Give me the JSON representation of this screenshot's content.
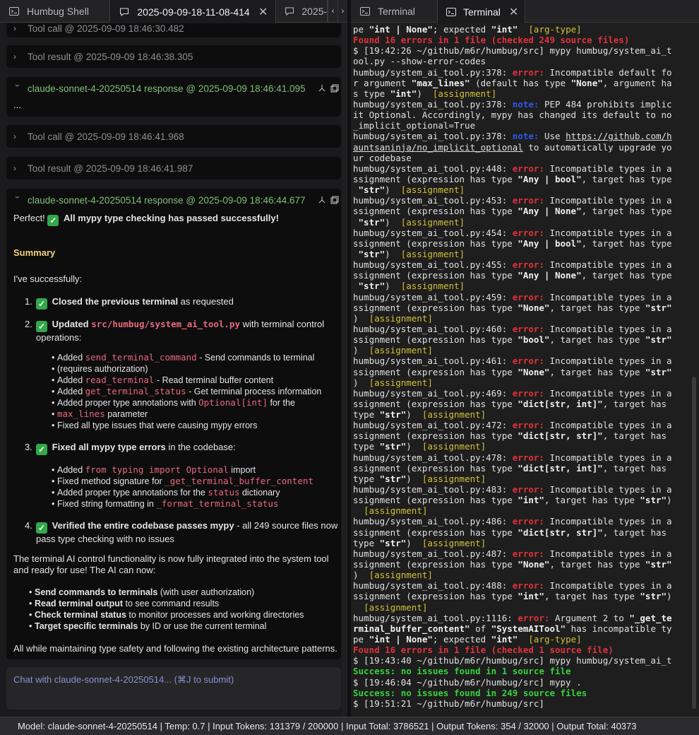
{
  "left_tabs": [
    {
      "label": "Humbug Shell",
      "icon": "terminal-icon"
    },
    {
      "label": "2025-09-09-18-11-08-414",
      "icon": "chat-icon",
      "active": true
    },
    {
      "label": "2025-0",
      "icon": "chat-icon"
    }
  ],
  "right_tabs": [
    {
      "label": "Terminal",
      "icon": "terminal-icon"
    },
    {
      "label": "Terminal",
      "icon": "terminal-icon",
      "active": true
    }
  ],
  "left": {
    "cards": [
      {
        "header": "Tool call @ 2025-09-09 18:46:30.482"
      },
      {
        "header": "Tool result @ 2025-09-09 18:46:38.305"
      },
      {
        "header": "claude-sonnet-4-20250514 response @ 2025-09-09 18:46:41.095",
        "body": "..."
      },
      {
        "header": "Tool call @ 2025-09-09 18:46:41.968"
      },
      {
        "header": "Tool result @ 2025-09-09 18:46:41.987"
      },
      {
        "header": "claude-sonnet-4-20250514 response @ 2025-09-09 18:46:44.677"
      }
    ],
    "response": {
      "intro_a": "Perfect! ",
      "intro_b": "All mypy type checking has passed successfully!",
      "summary_title": "Summary",
      "lead": "I've successfully:",
      "items": [
        {
          "num": "1.",
          "bold": "Closed the previous terminal",
          "rest": " as requested"
        },
        {
          "num": "2.",
          "bold": "Updated ",
          "code": "src/humbug/system_ai_tool.py",
          "rest": " with terminal control",
          "rest2": "operations:"
        },
        {
          "num": "3.",
          "bold": "Fixed all mypy type errors",
          "rest": " in the codebase:"
        },
        {
          "num": "4.",
          "bold": "Verified the entire codebase passes mypy",
          "rest": " - all 249 source files now",
          "rest2": "pass type checking with no issues"
        }
      ],
      "sub2": [
        {
          "pre": "Added ",
          "code": "send_terminal_command",
          "post": " - Send commands to terminal"
        },
        {
          "pre": "(requires authorization)"
        },
        {
          "pre": "Added ",
          "code": "read_terminal",
          "post": " - Read terminal buffer content"
        },
        {
          "pre": "Added ",
          "code": "get_terminal_status",
          "post": " - Get terminal process information"
        },
        {
          "pre": "Added proper type annotations with ",
          "code": "Optional[int]",
          "post": " for the"
        },
        {
          "pre": "",
          "code": "max_lines",
          "post": " parameter"
        },
        {
          "pre": "Fixed all type issues that were causing mypy errors"
        }
      ],
      "sub3": [
        {
          "pre": "Added ",
          "code": "from typing import Optional",
          "post": " import"
        },
        {
          "pre": "Fixed method signature for ",
          "code": "_get_terminal_buffer_content",
          "post": ""
        },
        {
          "pre": "Added proper type annotations for the ",
          "code": "status",
          "post": " dictionary"
        },
        {
          "pre": "Fixed string formatting in ",
          "code": "_format_terminal_status",
          "post": ""
        }
      ],
      "para1": "The terminal AI control functionality is now fully integrated into the system tool",
      "para1b": "and ready for use! The AI can now:",
      "caps": [
        {
          "bold": "Send commands to terminals",
          "rest": " (with user authorization)"
        },
        {
          "bold": "Read terminal output",
          "rest": " to see command results"
        },
        {
          "bold": "Check terminal status",
          "rest": " to monitor processes and working directories"
        },
        {
          "bold": "Target specific terminals",
          "rest": " by ID or use the current terminal"
        }
      ],
      "closing": "All while maintaining type safety and following the existing architecture patterns."
    },
    "chat_placeholder": "Chat with claude-sonnet-4-20250514... (⌘J to submit)"
  },
  "terminal_lines": [
    [
      [
        "pe ",
        ""
      ],
      [
        "\"int | None\"",
        "b"
      ],
      [
        "; expected ",
        ""
      ],
      [
        "\"int\"",
        "b"
      ],
      [
        "  ",
        ""
      ],
      [
        "[arg-type]",
        "tag"
      ]
    ],
    [
      [
        "Found 16 errors in 1 file (checked 249 source files)",
        "red"
      ]
    ],
    [
      [
        "$ [19:42:26 ~/github/m6r/humbug/src] mypy humbug/system_ai_t",
        ""
      ]
    ],
    [
      [
        "ool.py --show-error-codes",
        ""
      ]
    ],
    [
      [
        "humbug/system_ai_tool.py:378: ",
        ""
      ],
      [
        "error:",
        "err"
      ],
      [
        " Incompatible default fo",
        ""
      ]
    ],
    [
      [
        "r argument ",
        ""
      ],
      [
        "\"max_lines\"",
        "b"
      ],
      [
        " (default has type ",
        ""
      ],
      [
        "\"None\"",
        "b"
      ],
      [
        ", argument ha",
        ""
      ]
    ],
    [
      [
        "s type ",
        ""
      ],
      [
        "\"int\"",
        "b"
      ],
      [
        ")  ",
        ""
      ],
      [
        "[assignment]",
        "tag"
      ]
    ],
    [
      [
        "humbug/system_ai_tool.py:378: ",
        ""
      ],
      [
        "note:",
        "note"
      ],
      [
        " PEP 484 prohibits implic",
        ""
      ]
    ],
    [
      [
        "it Optional. Accordingly, mypy has changed its default to no",
        ""
      ]
    ],
    [
      [
        "_implicit_optional=True",
        ""
      ]
    ],
    [
      [
        "humbug/system_ai_tool.py:378: ",
        ""
      ],
      [
        "note:",
        "note"
      ],
      [
        " Use ",
        ""
      ],
      [
        "https://github.com/h",
        "link"
      ]
    ],
    [
      [
        "auntsaninja/no_implicit_optional",
        "link"
      ],
      [
        " to automatically upgrade yo",
        ""
      ]
    ],
    [
      [
        "ur codebase",
        ""
      ]
    ],
    [
      [
        "humbug/system_ai_tool.py:448: ",
        ""
      ],
      [
        "error:",
        "err"
      ],
      [
        " Incompatible types in a",
        ""
      ]
    ],
    [
      [
        "ssignment (expression has type ",
        ""
      ],
      [
        "\"Any | bool\"",
        "b"
      ],
      [
        ", target has type",
        ""
      ]
    ],
    [
      [
        " ",
        ""
      ],
      [
        "\"str\"",
        "b"
      ],
      [
        ")  ",
        ""
      ],
      [
        "[assignment]",
        "tag"
      ]
    ],
    [
      [
        "humbug/system_ai_tool.py:453: ",
        ""
      ],
      [
        "error:",
        "err"
      ],
      [
        " Incompatible types in a",
        ""
      ]
    ],
    [
      [
        "ssignment (expression has type ",
        ""
      ],
      [
        "\"Any | None\"",
        "b"
      ],
      [
        ", target has type",
        ""
      ]
    ],
    [
      [
        " ",
        ""
      ],
      [
        "\"str\"",
        "b"
      ],
      [
        ")  ",
        ""
      ],
      [
        "[assignment]",
        "tag"
      ]
    ],
    [
      [
        "humbug/system_ai_tool.py:454: ",
        ""
      ],
      [
        "error:",
        "err"
      ],
      [
        " Incompatible types in a",
        ""
      ]
    ],
    [
      [
        "ssignment (expression has type ",
        ""
      ],
      [
        "\"Any | bool\"",
        "b"
      ],
      [
        ", target has type",
        ""
      ]
    ],
    [
      [
        " ",
        ""
      ],
      [
        "\"str\"",
        "b"
      ],
      [
        ")  ",
        ""
      ],
      [
        "[assignment]",
        "tag"
      ]
    ],
    [
      [
        "humbug/system_ai_tool.py:455: ",
        ""
      ],
      [
        "error:",
        "err"
      ],
      [
        " Incompatible types in a",
        ""
      ]
    ],
    [
      [
        "ssignment (expression has type ",
        ""
      ],
      [
        "\"Any | None\"",
        "b"
      ],
      [
        ", target has type",
        ""
      ]
    ],
    [
      [
        " ",
        ""
      ],
      [
        "\"str\"",
        "b"
      ],
      [
        ")  ",
        ""
      ],
      [
        "[assignment]",
        "tag"
      ]
    ],
    [
      [
        "humbug/system_ai_tool.py:459: ",
        ""
      ],
      [
        "error:",
        "err"
      ],
      [
        " Incompatible types in a",
        ""
      ]
    ],
    [
      [
        "ssignment (expression has type ",
        ""
      ],
      [
        "\"None\"",
        "b"
      ],
      [
        ", target has type ",
        ""
      ],
      [
        "\"str\"",
        "b"
      ]
    ],
    [
      [
        ")  ",
        ""
      ],
      [
        "[assignment]",
        "tag"
      ]
    ],
    [
      [
        "humbug/system_ai_tool.py:460: ",
        ""
      ],
      [
        "error:",
        "err"
      ],
      [
        " Incompatible types in a",
        ""
      ]
    ],
    [
      [
        "ssignment (expression has type ",
        ""
      ],
      [
        "\"bool\"",
        "b"
      ],
      [
        ", target has type ",
        ""
      ],
      [
        "\"str\"",
        "b"
      ]
    ],
    [
      [
        ")  ",
        ""
      ],
      [
        "[assignment]",
        "tag"
      ]
    ],
    [
      [
        "humbug/system_ai_tool.py:461: ",
        ""
      ],
      [
        "error:",
        "err"
      ],
      [
        " Incompatible types in a",
        ""
      ]
    ],
    [
      [
        "ssignment (expression has type ",
        ""
      ],
      [
        "\"None\"",
        "b"
      ],
      [
        ", target has type ",
        ""
      ],
      [
        "\"str\"",
        "b"
      ]
    ],
    [
      [
        ")  ",
        ""
      ],
      [
        "[assignment]",
        "tag"
      ]
    ],
    [
      [
        "humbug/system_ai_tool.py:469: ",
        ""
      ],
      [
        "error:",
        "err"
      ],
      [
        " Incompatible types in a",
        ""
      ]
    ],
    [
      [
        "ssignment (expression has type ",
        ""
      ],
      [
        "\"dict[str, int]\"",
        "b"
      ],
      [
        ", target has",
        ""
      ]
    ],
    [
      [
        "type ",
        ""
      ],
      [
        "\"str\"",
        "b"
      ],
      [
        ")  ",
        ""
      ],
      [
        "[assignment]",
        "tag"
      ]
    ],
    [
      [
        "humbug/system_ai_tool.py:472: ",
        ""
      ],
      [
        "error:",
        "err"
      ],
      [
        " Incompatible types in a",
        ""
      ]
    ],
    [
      [
        "ssignment (expression has type ",
        ""
      ],
      [
        "\"dict[str, str]\"",
        "b"
      ],
      [
        ", target has",
        ""
      ]
    ],
    [
      [
        "type ",
        ""
      ],
      [
        "\"str\"",
        "b"
      ],
      [
        ")  ",
        ""
      ],
      [
        "[assignment]",
        "tag"
      ]
    ],
    [
      [
        "humbug/system_ai_tool.py:478: ",
        ""
      ],
      [
        "error:",
        "err"
      ],
      [
        " Incompatible types in a",
        ""
      ]
    ],
    [
      [
        "ssignment (expression has type ",
        ""
      ],
      [
        "\"dict[str, int]\"",
        "b"
      ],
      [
        ", target has",
        ""
      ]
    ],
    [
      [
        "type ",
        ""
      ],
      [
        "\"str\"",
        "b"
      ],
      [
        ")  ",
        ""
      ],
      [
        "[assignment]",
        "tag"
      ]
    ],
    [
      [
        "humbug/system_ai_tool.py:483: ",
        ""
      ],
      [
        "error:",
        "err"
      ],
      [
        " Incompatible types in a",
        ""
      ]
    ],
    [
      [
        "ssignment (expression has type ",
        ""
      ],
      [
        "\"int\"",
        "b"
      ],
      [
        ", target has type ",
        ""
      ],
      [
        "\"str\"",
        "b"
      ],
      [
        ")",
        ""
      ]
    ],
    [
      [
        "  ",
        ""
      ],
      [
        "[assignment]",
        "tag"
      ]
    ],
    [
      [
        "humbug/system_ai_tool.py:486: ",
        ""
      ],
      [
        "error:",
        "err"
      ],
      [
        " Incompatible types in a",
        ""
      ]
    ],
    [
      [
        "ssignment (expression has type ",
        ""
      ],
      [
        "\"dict[str, str]\"",
        "b"
      ],
      [
        ", target has",
        ""
      ]
    ],
    [
      [
        "type ",
        ""
      ],
      [
        "\"str\"",
        "b"
      ],
      [
        ")  ",
        ""
      ],
      [
        "[assignment]",
        "tag"
      ]
    ],
    [
      [
        "humbug/system_ai_tool.py:487: ",
        ""
      ],
      [
        "error:",
        "err"
      ],
      [
        " Incompatible types in a",
        ""
      ]
    ],
    [
      [
        "ssignment (expression has type ",
        ""
      ],
      [
        "\"None\"",
        "b"
      ],
      [
        ", target has type ",
        ""
      ],
      [
        "\"str\"",
        "b"
      ]
    ],
    [
      [
        ")  ",
        ""
      ],
      [
        "[assignment]",
        "tag"
      ]
    ],
    [
      [
        "humbug/system_ai_tool.py:488: ",
        ""
      ],
      [
        "error:",
        "err"
      ],
      [
        " Incompatible types in a",
        ""
      ]
    ],
    [
      [
        "ssignment (expression has type ",
        ""
      ],
      [
        "\"int\"",
        "b"
      ],
      [
        ", target has type ",
        ""
      ],
      [
        "\"str\"",
        "b"
      ],
      [
        ")",
        ""
      ]
    ],
    [
      [
        "  ",
        ""
      ],
      [
        "[assignment]",
        "tag"
      ]
    ],
    [
      [
        "humbug/system_ai_tool.py:1116: ",
        ""
      ],
      [
        "error:",
        "err"
      ],
      [
        " Argument 2 to ",
        ""
      ],
      [
        "\"_get_te",
        "b"
      ]
    ],
    [
      [
        "rminal_buffer_content\"",
        "b"
      ],
      [
        " of ",
        ""
      ],
      [
        "\"SystemAITool\"",
        "b"
      ],
      [
        " has incompatible ty",
        ""
      ]
    ],
    [
      [
        "pe ",
        ""
      ],
      [
        "\"int | None\"",
        "b"
      ],
      [
        "; expected ",
        ""
      ],
      [
        "\"int\"",
        "b"
      ],
      [
        "  ",
        ""
      ],
      [
        "[arg-type]",
        "tag"
      ]
    ],
    [
      [
        "Found 16 errors in 1 file (checked 1 source file)",
        "red"
      ]
    ],
    [
      [
        "$ [19:43:40 ~/github/m6r/humbug/src] mypy humbug/system_ai_t",
        ""
      ]
    ],
    [
      [
        "Success: no issues found in 1 source file",
        "green"
      ]
    ],
    [
      [
        "$ [19:46:04 ~/github/m6r/humbug/src] mypy .",
        ""
      ]
    ],
    [
      [
        "Success: no issues found in 249 source files",
        "green"
      ]
    ],
    [
      [
        "$ [19:51:21 ~/github/m6r/humbug/src]",
        ""
      ]
    ]
  ],
  "status_bar": "Model: claude-sonnet-4-20250514  |  Temp: 0.7  |  Input Tokens: 131379 / 200000  |  Input Total: 3786521  |  Output Tokens: 354 / 32000  |  Output Total: 40373"
}
